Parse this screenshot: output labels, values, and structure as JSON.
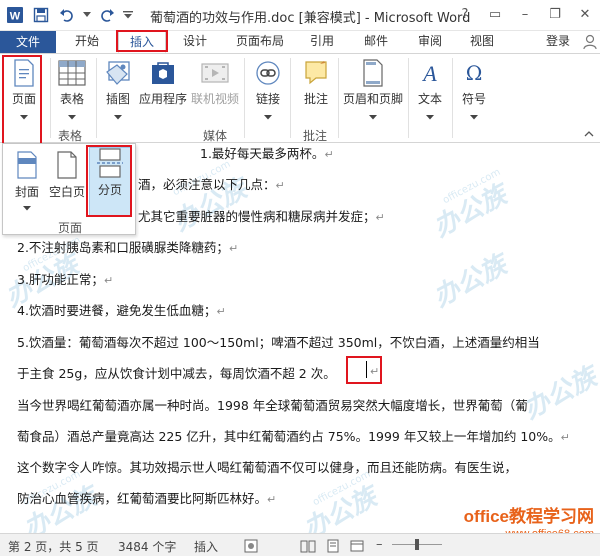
{
  "window": {
    "title": "葡萄酒的功效与作用.doc [兼容模式] - Microsoft Word",
    "controls": [
      "?",
      "▭",
      "–",
      "❐",
      "✕"
    ]
  },
  "tabs": [
    "文件",
    "开始",
    "插入",
    "设计",
    "页面布局",
    "引用",
    "邮件",
    "审阅",
    "视图"
  ],
  "account": "登录",
  "ribbon": {
    "buttons": {
      "page": "页面",
      "table": "表格",
      "picture": "插图",
      "apps": "应用程序",
      "online_video": "联机视频",
      "link": "链接",
      "comment": "批注",
      "header_footer": "页眉和页脚",
      "text": "文本",
      "symbol": "符号"
    },
    "groups": {
      "table": "表格",
      "media": "媒体",
      "comment": "批注"
    }
  },
  "dropdown": {
    "cover": "封面",
    "blank": "空白页",
    "break": "分页",
    "group": "页面"
  },
  "document": {
    "lines": [
      "1.最好每天最多两杯。",
      "酒，必须注意以下几点：",
      "尤其它重要脏器的慢性病和糖尿病并发症；",
      "2.不注射胰岛素和口服磺脲类降糖药；",
      "3.肝功能正常；",
      "4.饮酒时要进餐，避免发生低血糖；",
      "5.饮酒量：葡萄酒每次不超过 100～150ml；啤酒不超过 350ml，不饮白酒，上述酒量约相当",
      "于主食 25g，应从饮食计划中减去，每周饮酒不超 2 次。",
      "当今世界喝红葡萄酒亦属一种时尚。1998 年全球葡萄酒贸易突然大幅度增长，世界葡萄（葡",
      "萄食品）酒总产量竟高达 225 亿升，其中红葡萄酒约占 75%。1999 年又较上一年增加约 10%。",
      "这个数字令人咋惊。其功效揭示世人喝红葡萄酒不仅可以健身，而且还能防病。有医生说，",
      "防治心血管疾病，红葡萄酒要比阿斯匹林好。"
    ],
    "para_mark": "↵"
  },
  "watermark": {
    "text": "办公族",
    "sub": "officezu.com"
  },
  "site": {
    "name": "office教程学习网",
    "url": "www.office68.com"
  },
  "status": {
    "page": "第 2 页，共 5 页",
    "words": "3484 个字",
    "mode": "插入"
  },
  "colors": {
    "accent": "#2b579a",
    "highlight": "#e0151e",
    "selected": "#cde6f7"
  }
}
